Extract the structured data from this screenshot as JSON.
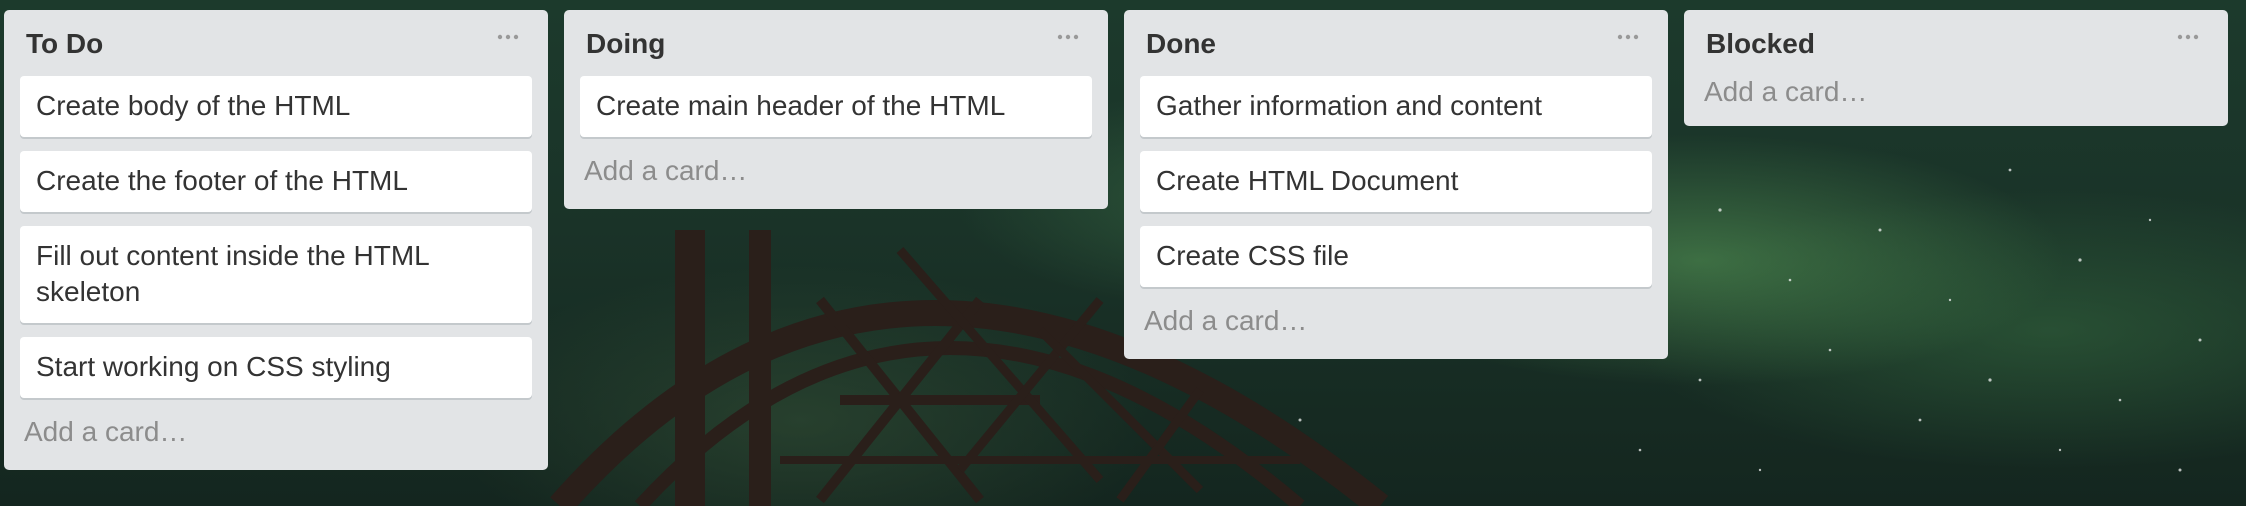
{
  "colors": {
    "list_bg": "#e2e4e6",
    "card_bg": "#ffffff",
    "text": "#333333",
    "muted_text": "#8c8c8c"
  },
  "lists": [
    {
      "title": "To Do",
      "menu_icon": "ellipsis-icon",
      "cards": [
        "Create body of the HTML",
        "Create the footer of the HTML",
        "Fill out content inside the HTML skeleton",
        "Start working on CSS styling"
      ],
      "add_card_label": "Add a card…"
    },
    {
      "title": "Doing",
      "menu_icon": "ellipsis-icon",
      "cards": [
        "Create main header of the HTML"
      ],
      "add_card_label": "Add a card…"
    },
    {
      "title": "Done",
      "menu_icon": "ellipsis-icon",
      "cards": [
        "Gather information and content",
        "Create HTML Document",
        "Create CSS file"
      ],
      "add_card_label": "Add a card…"
    },
    {
      "title": "Blocked",
      "menu_icon": "ellipsis-icon",
      "cards": [],
      "add_card_label": "Add a card…"
    }
  ]
}
